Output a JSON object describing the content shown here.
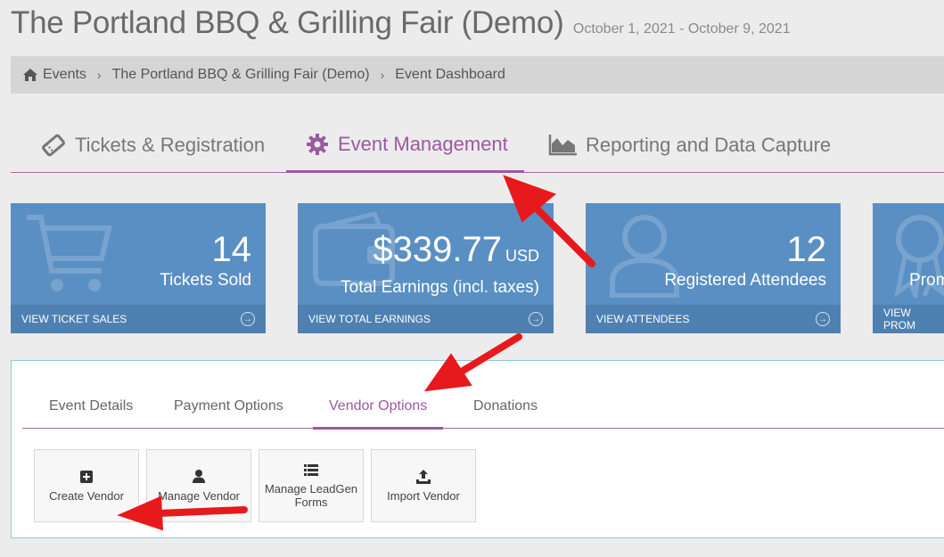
{
  "header": {
    "title": "The Portland BBQ & Grilling Fair (Demo)",
    "dates": "October 1, 2021 - October 9, 2021"
  },
  "breadcrumb": {
    "home_icon": "home-icon",
    "items": [
      "Events",
      "The Portland BBQ & Grilling Fair (Demo)",
      "Event Dashboard"
    ]
  },
  "main_tabs": [
    {
      "label": "Tickets & Registration",
      "icon": "ticket-icon",
      "active": false
    },
    {
      "label": "Event Management",
      "icon": "gear-icon",
      "active": true
    },
    {
      "label": "Reporting and Data Capture",
      "icon": "area-chart-icon",
      "active": false
    }
  ],
  "stats": [
    {
      "value": "14",
      "unit": "",
      "label": "Tickets Sold",
      "link": "VIEW TICKET SALES",
      "icon": "cart-icon"
    },
    {
      "value": "$339.77",
      "unit": "USD",
      "label": "Total Earnings (incl. taxes)",
      "link": "VIEW TOTAL EARNINGS",
      "icon": "wallet-icon"
    },
    {
      "value": "12",
      "unit": "",
      "label": "Registered Attendees",
      "link": "VIEW ATTENDEES",
      "icon": "user-icon"
    },
    {
      "value": "",
      "unit": "",
      "label": "Prom",
      "link": "VIEW PROM",
      "icon": "ribbon-icon"
    }
  ],
  "sub_tabs": [
    {
      "label": "Event Details",
      "active": false
    },
    {
      "label": "Payment Options",
      "active": false
    },
    {
      "label": "Vendor Options",
      "active": true
    },
    {
      "label": "Donations",
      "active": false
    }
  ],
  "vendor_actions": [
    {
      "label": "Create Vendor",
      "icon": "plus-square-icon"
    },
    {
      "label": "Manage Vendor",
      "icon": "user-icon"
    },
    {
      "label": "Manage LeadGen Forms",
      "icon": "list-icon"
    },
    {
      "label": "Import Vendor",
      "icon": "upload-icon"
    }
  ],
  "colors": {
    "accent": "#9a5aa0",
    "card": "#5a8fc3",
    "card_footer": "#4e80b2",
    "annotation_arrow": "#e8191c"
  }
}
